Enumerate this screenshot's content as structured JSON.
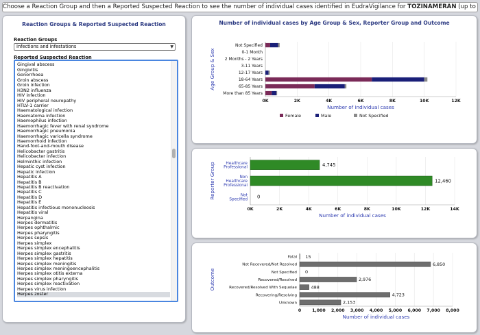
{
  "banner": {
    "text_before": "Choose a Reaction Group and then a Reported Suspected Reaction to see the number of individual cases identified in EudraVigilance for ",
    "product": "TOZINAMERAN",
    "text_after": " (up to 28/11/2022)"
  },
  "left_panel": {
    "title": "Reaction Groups & Reported Suspected Reaction",
    "group_label": "Reaction Groups",
    "group_value": "Infections and infestations",
    "reaction_label": "Reported Suspected Reaction",
    "reactions": [
      "Gastroenteritis",
      "Gingival abscess",
      "Gingivitis",
      "Gonorrhoea",
      "Groin abscess",
      "Groin infection",
      "H3N2 influenza",
      "HIV infection",
      "HIV peripheral neuropathy",
      "HTLV-1 carrier",
      "Haematological infection",
      "Haematoma infection",
      "Haemophilus infection",
      "Haemorrhagic fever with renal syndrome",
      "Haemorrhagic pneumonia",
      "Haemorrhagic varicella syndrome",
      "Haemorrhoid infection",
      "Hand-foot-and-mouth disease",
      "Helicobacter gastritis",
      "Helicobacter infection",
      "Helminthic infection",
      "Hepatic cyst infection",
      "Hepatic infection",
      "Hepatitis A",
      "Hepatitis B",
      "Hepatitis B reactivation",
      "Hepatitis C",
      "Hepatitis D",
      "Hepatitis E",
      "Hepatitis infectious mononucleosis",
      "Hepatitis viral",
      "Herpangina",
      "Herpes dermatitis",
      "Herpes ophthalmic",
      "Herpes pharyngitis",
      "Herpes sepsis",
      "Herpes simplex",
      "Herpes simplex encephalitis",
      "Herpes simplex gastritis",
      "Herpes simplex hepatitis",
      "Herpes simplex meningitis",
      "Herpes simplex meningoencephalitis",
      "Herpes simplex otitis externa",
      "Herpes simplex pharyngitis",
      "Herpes simplex reactivation",
      "Herpes virus infection",
      "Herpes zoster"
    ],
    "selected_index": 46
  },
  "colors": {
    "female": "#7a2a58",
    "male": "#1a1f78",
    "not_specified": "#8a8a8a",
    "green": "#2f8a26",
    "grey_bar": "#6e6e6e",
    "title": "#2c3a82",
    "axis_label": "#2d3bb0"
  },
  "chart_data": [
    {
      "type": "bar",
      "orientation": "horizontal",
      "stacked": true,
      "title": "Number of individual cases by Age Group & Sex, Reporter Group and Outcome",
      "ylabel": "Age Group & Sex",
      "xlabel": "Number of individual cases",
      "categories": [
        "Not Specified",
        "0-1 Month",
        "2 Months - 2 Years",
        "3-11 Years",
        "12-17 Years",
        "18-64 Years",
        "65-85 Years",
        "More than 85 Years"
      ],
      "series": [
        {
          "name": "Female",
          "values": [
            300,
            0,
            0,
            0,
            0,
            6700,
            3100,
            400
          ]
        },
        {
          "name": "Male",
          "values": [
            500,
            0,
            0,
            0,
            200,
            3300,
            1900,
            300
          ]
        },
        {
          "name": "Not Specified",
          "values": [
            100,
            0,
            0,
            0,
            80,
            200,
            100,
            40
          ]
        }
      ],
      "xlim": [
        0,
        12000
      ],
      "xticks": [
        "0K",
        "2K",
        "4K",
        "6K",
        "8K",
        "10K",
        "12K"
      ],
      "legend": "bottom"
    },
    {
      "type": "bar",
      "orientation": "horizontal",
      "ylabel": "Reporter Group",
      "xlabel": "Number of individual cases",
      "categories": [
        "Healthcare Professional",
        "Non Healthcare Professional",
        "Not Specified"
      ],
      "values": [
        4745,
        12460,
        0
      ],
      "labels": [
        "4,745",
        "12,460",
        "0"
      ],
      "xlim": [
        0,
        14000
      ],
      "xticks": [
        "0K",
        "2K",
        "4K",
        "6K",
        "8K",
        "10K",
        "12K",
        "14K"
      ]
    },
    {
      "type": "bar",
      "orientation": "horizontal",
      "ylabel": "Outcome",
      "xlabel": "Number of individual cases",
      "categories": [
        "Fatal",
        "Not Recovered/Not Resolved",
        "Not Specified",
        "Recovered/Resolved",
        "Recovered/Resolved With Sequelae",
        "Recovering/Resolving",
        "Unknown"
      ],
      "values": [
        15,
        6850,
        0,
        2976,
        488,
        4723,
        2153
      ],
      "labels": [
        "15",
        "6,850",
        "0",
        "2,976",
        "488",
        "4,723",
        "2,153"
      ],
      "xlim": [
        0,
        8000
      ],
      "xticks": [
        "0",
        "1,000",
        "2,000",
        "3,000",
        "4,000",
        "5,000",
        "6,000",
        "7,000",
        "8,000"
      ]
    }
  ]
}
